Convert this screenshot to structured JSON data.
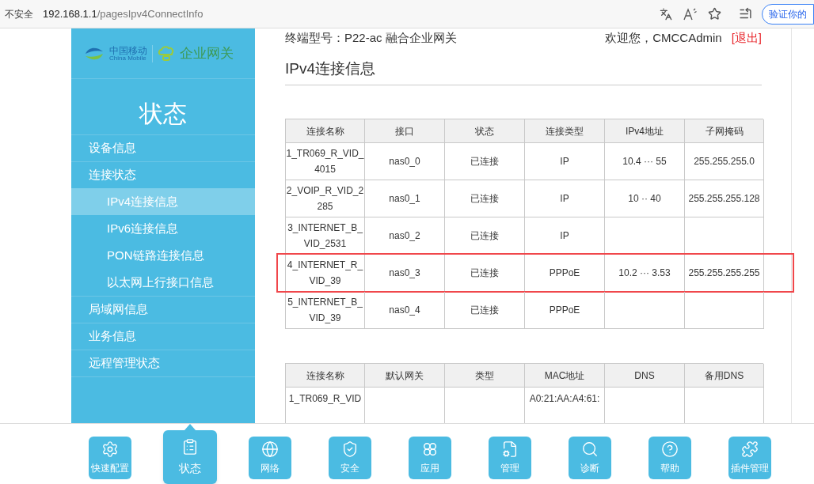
{
  "browser": {
    "security_label": "不安全",
    "url_host": "192.168.1.1",
    "url_path": "/pagesIpv4ConnectInfo",
    "verify_button": "验证你的"
  },
  "logo": {
    "brand_cn": "中国移动",
    "brand_en": "China Mobile",
    "product": "企业网关"
  },
  "sidebar": {
    "title": "状态",
    "items": [
      {
        "label": "设备信息",
        "selected": false
      },
      {
        "label": "连接状态",
        "selected": false,
        "children": [
          {
            "label": "IPv4连接信息",
            "selected": true
          },
          {
            "label": "IPv6连接信息",
            "selected": false
          },
          {
            "label": "PON链路连接信息",
            "selected": false
          },
          {
            "label": "以太网上行接口信息",
            "selected": false
          }
        ]
      },
      {
        "label": "局域网信息",
        "selected": false
      },
      {
        "label": "业务信息",
        "selected": false
      },
      {
        "label": "远程管理状态",
        "selected": false
      }
    ]
  },
  "header": {
    "model": "终端型号：P22-ac 融合企业网关",
    "welcome": "欢迎您，CMCCAdmin",
    "logout": "[退出]"
  },
  "section_title": "IPv4连接信息",
  "tables": [
    {
      "columns": [
        "连接名称",
        "接口",
        "状态",
        "连接类型",
        "IPv4地址",
        "子网掩码"
      ],
      "rows": [
        {
          "cells": [
            "1_TR069_R_VID_\n4015",
            "nas0_0",
            "已连接",
            "IP",
            "10.4 ··· 55",
            "255.255.255.0"
          ],
          "highlighted": false
        },
        {
          "cells": [
            "2_VOIP_R_VID_2\n285",
            "nas0_1",
            "已连接",
            "IP",
            "10 ·· 40",
            "255.255.255.128"
          ],
          "highlighted": false
        },
        {
          "cells": [
            "3_INTERNET_B_\nVID_2531",
            "nas0_2",
            "已连接",
            "IP",
            "",
            ""
          ],
          "highlighted": false
        },
        {
          "cells": [
            "4_INTERNET_R_\nVID_39",
            "nas0_3",
            "已连接",
            "PPPoE",
            "10.2 ··· 3.53",
            "255.255.255.255"
          ],
          "highlighted": true
        },
        {
          "cells": [
            "5_INTERNET_B_\nVID_39",
            "nas0_4",
            "已连接",
            "PPPoE",
            "",
            ""
          ],
          "highlighted": false
        }
      ]
    },
    {
      "columns": [
        "连接名称",
        "默认网关",
        "类型",
        "MAC地址",
        "DNS",
        "备用DNS"
      ],
      "rows": [
        {
          "cells": [
            "1_TR069_R_VID",
            "",
            "",
            "A0:21:AA:A4:61:",
            "",
            ""
          ],
          "highlighted": false
        }
      ]
    }
  ],
  "bottom_nav": [
    {
      "label": "快速配置",
      "selected": false
    },
    {
      "label": "状态",
      "selected": true
    },
    {
      "label": "网络",
      "selected": false
    },
    {
      "label": "安全",
      "selected": false
    },
    {
      "label": "应用",
      "selected": false
    },
    {
      "label": "管理",
      "selected": false
    },
    {
      "label": "诊断",
      "selected": false
    },
    {
      "label": "帮助",
      "selected": false
    },
    {
      "label": "插件管理",
      "selected": false
    }
  ]
}
